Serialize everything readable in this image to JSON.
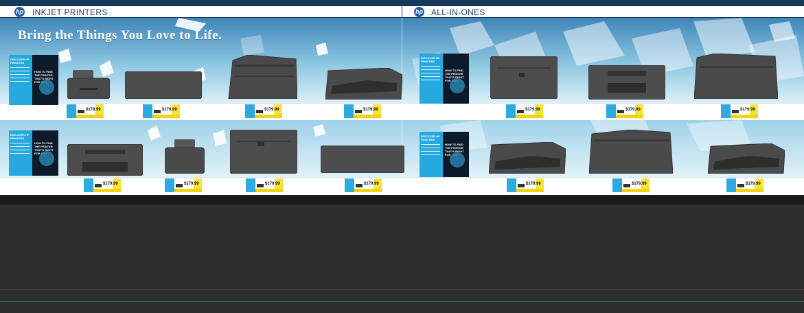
{
  "header": {
    "left_label": "INKJET PRINTERS",
    "right_label": "ALL-IN-ONES",
    "logo_text": "hp"
  },
  "banner": {
    "tagline": "Bring the Things You Love to Life."
  },
  "poster": {
    "left_title": "DISCOVER HP PRINTERS",
    "right_title": "HOW TO FIND THE PRINTER THAT'S RIGHT FOR YOU"
  },
  "price_tag": {
    "price": "$179.99"
  },
  "colors": {
    "header_bg": "#16385a",
    "accent_blue": "#2dabe0",
    "tag_yellow": "#f7e33a",
    "printer_body": "#4a4a4a",
    "counter": "#2e2e2e"
  }
}
